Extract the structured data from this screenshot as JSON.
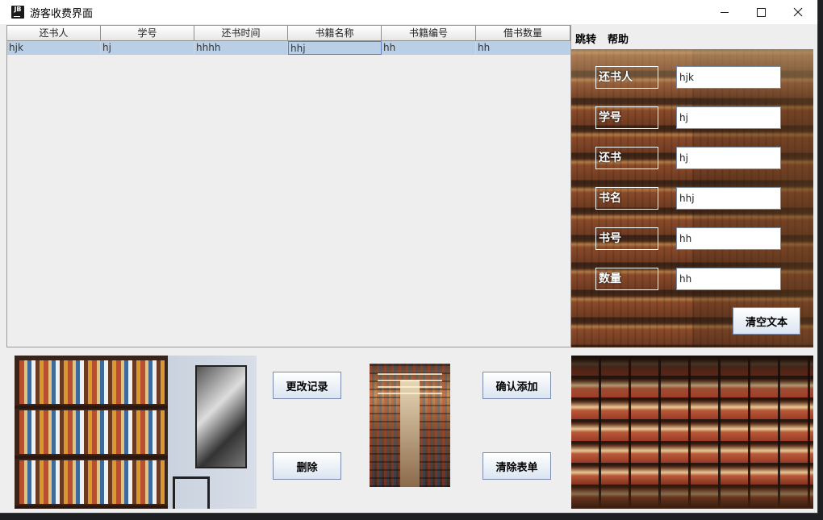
{
  "window": {
    "title": "游客收费界面",
    "app_icon": "JB"
  },
  "table": {
    "columns": [
      "还书人",
      "学号",
      "还书时间",
      "书籍名称",
      "书籍编号",
      "借书数量"
    ],
    "rows": [
      [
        "hjk",
        "hj",
        "hhhh",
        "hhj",
        "hh",
        "hh"
      ]
    ]
  },
  "menu": {
    "items": [
      "跳转",
      "帮助"
    ]
  },
  "form": {
    "fields": [
      {
        "label": "还书人",
        "value": "hjk"
      },
      {
        "label": "学号",
        "value": "hj"
      },
      {
        "label": "还书",
        "value": "hj"
      },
      {
        "label": "书名",
        "value": "hhj"
      },
      {
        "label": "书号",
        "value": "hh"
      },
      {
        "label": "数量",
        "value": "hh"
      }
    ],
    "clear_text_label": "清空文本"
  },
  "actions": {
    "update_label": "更改记录",
    "confirm_add_label": "确认添加",
    "delete_label": "删除",
    "clear_form_label": "清除表单"
  },
  "colors": {
    "selected_row": "#b8cfe5",
    "panel_bg": "#eeeeee",
    "button_border": "#7a8aa8"
  }
}
